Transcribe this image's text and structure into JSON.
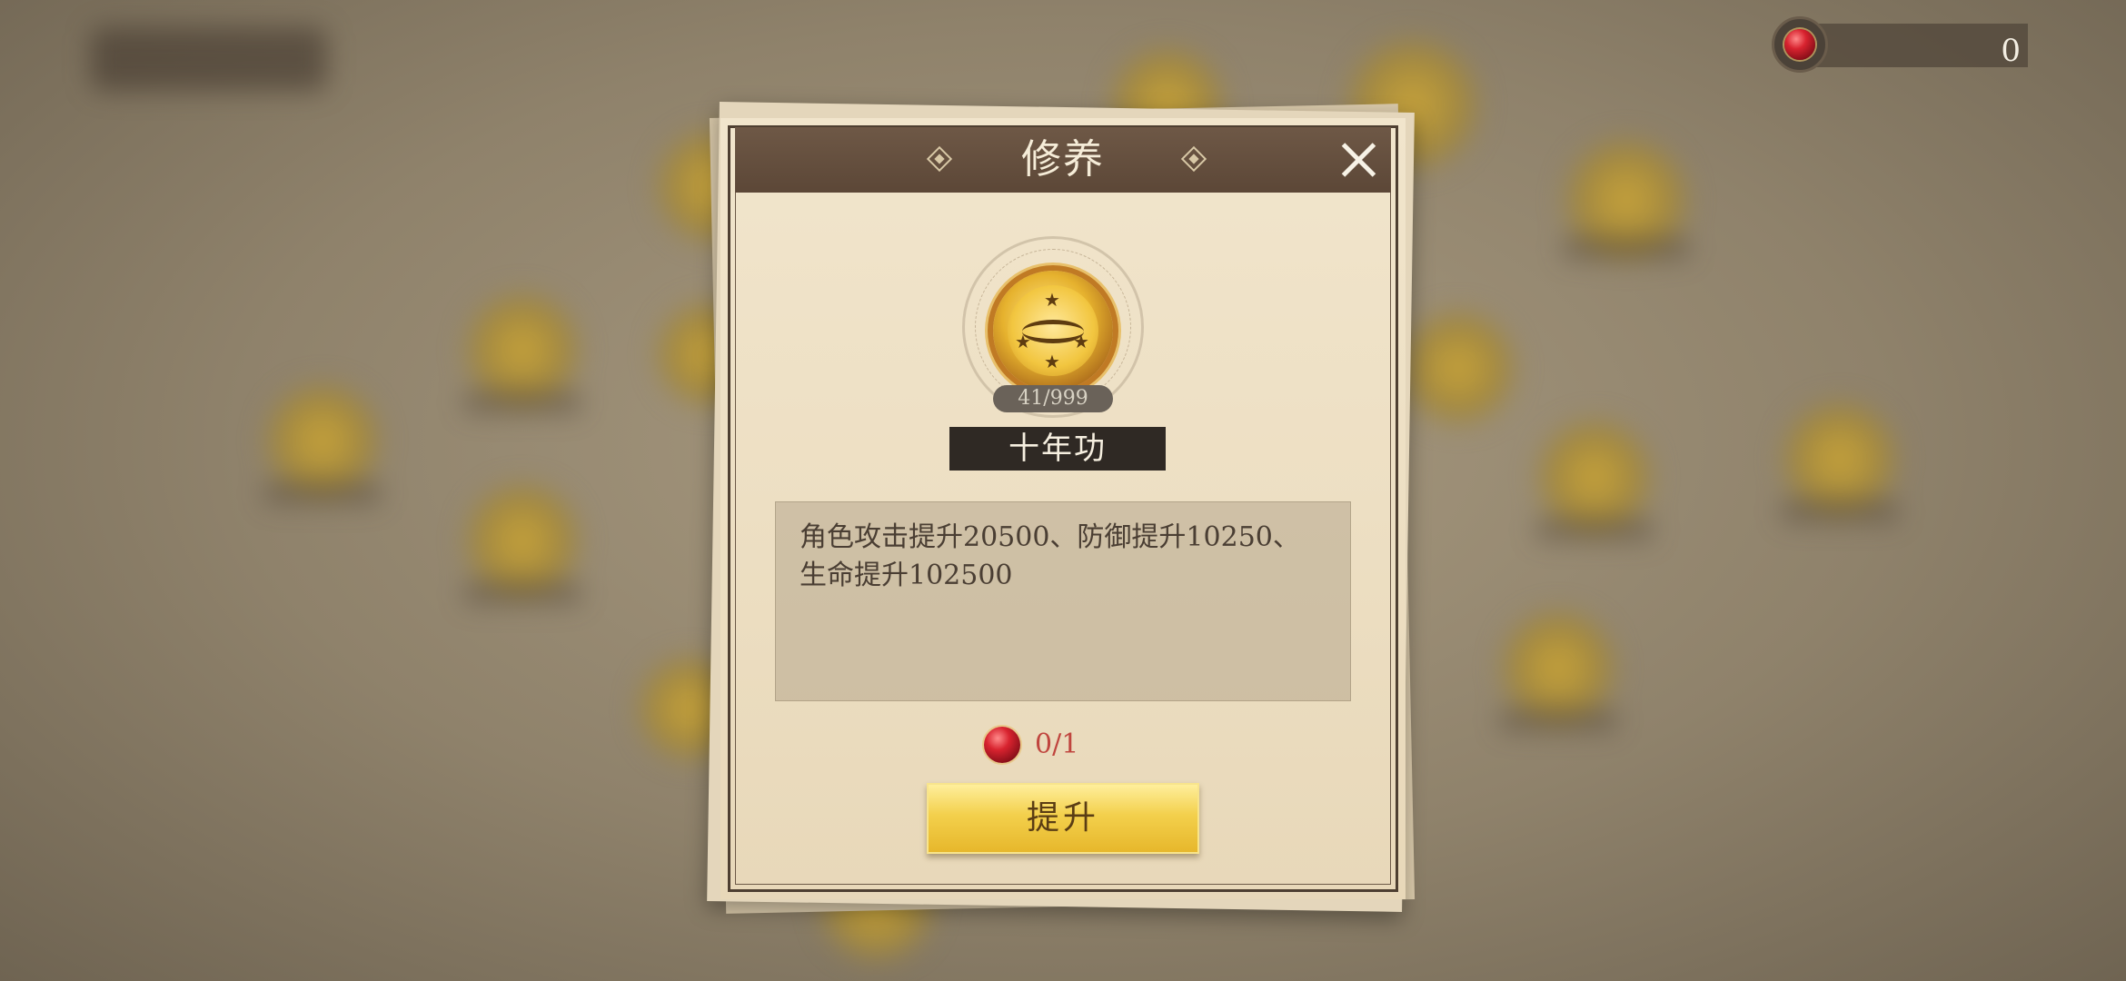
{
  "currency": {
    "value": "0",
    "icon": "red-gem-icon"
  },
  "dialog": {
    "title": "修养",
    "skill": {
      "icon": "eye-medal-icon",
      "progress": "41/999",
      "name": "十年功"
    },
    "description": "角色攻击提升20500、防御提升10250、生命提升102500",
    "cost": {
      "icon": "red-gem-icon",
      "text": "0/1"
    },
    "button_label": "提升"
  },
  "colors": {
    "header": "#5c4737",
    "button": "#f3d04c",
    "cost_text": "#c0453e",
    "name_plate": "#2f2924"
  }
}
